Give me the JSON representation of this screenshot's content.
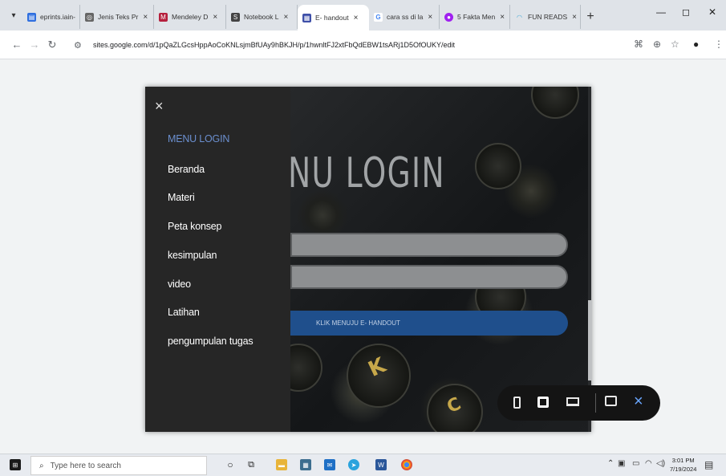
{
  "browser": {
    "tabs": [
      {
        "title": "eprints.iain-",
        "favicon": "document-icon",
        "color": "#2f6fdf"
      },
      {
        "title": "Jenis Teks Pr",
        "favicon": "globe-icon",
        "color": "#555555"
      },
      {
        "title": "Mendeley D",
        "favicon": "mendeley-icon",
        "color": "#b5203d"
      },
      {
        "title": "Notebook L",
        "favicon": "notebook-icon",
        "color": "#444444"
      },
      {
        "title": "E- handout",
        "favicon": "google-sites-icon",
        "color": "#3e4fa8",
        "active": true
      },
      {
        "title": "cara ss di la",
        "favicon": "google-icon",
        "color": "#4285f4"
      },
      {
        "title": "5 Fakta Men",
        "favicon": "circle-icon",
        "color": "#a020f0"
      },
      {
        "title": "FUN READS",
        "favicon": "loading-icon",
        "color": "#3fa7d6"
      }
    ],
    "new_tab_label": "+",
    "close_glyph": "×",
    "url": "sites.google.com/d/1pQaZLGcsHppAoCoKNLsjmBfUAy9hBKJH/p/1hwnltFJ2xtFbQdEBW1tsARj1D5OfOUKY/edit"
  },
  "site": {
    "close_label": "×",
    "menu": [
      {
        "label": "MENU LOGIN",
        "active": true
      },
      {
        "label": "Beranda"
      },
      {
        "label": "Materi"
      },
      {
        "label": "Peta konsep"
      },
      {
        "label": "kesimpulan"
      },
      {
        "label": "video"
      },
      {
        "label": "Latihan"
      },
      {
        "label": "pengumpulan tugas"
      }
    ],
    "hero_title": "ENU LOGIN",
    "handout_button": "KLIK MENUJU E- HANDOUT"
  },
  "preview_bar": {
    "icons": [
      "phone-preview-icon",
      "tablet-preview-icon",
      "laptop-preview-icon",
      "feedback-icon",
      "close-preview-icon"
    ],
    "close_glyph": "×"
  },
  "taskbar": {
    "search_placeholder": "Type here to search",
    "time": "3:01 PM",
    "date": "7/19/2024"
  },
  "colors": {
    "accent_menu": "#6b8fcf",
    "handout_button": "#1f4f8c",
    "sidebar": "#262626"
  }
}
